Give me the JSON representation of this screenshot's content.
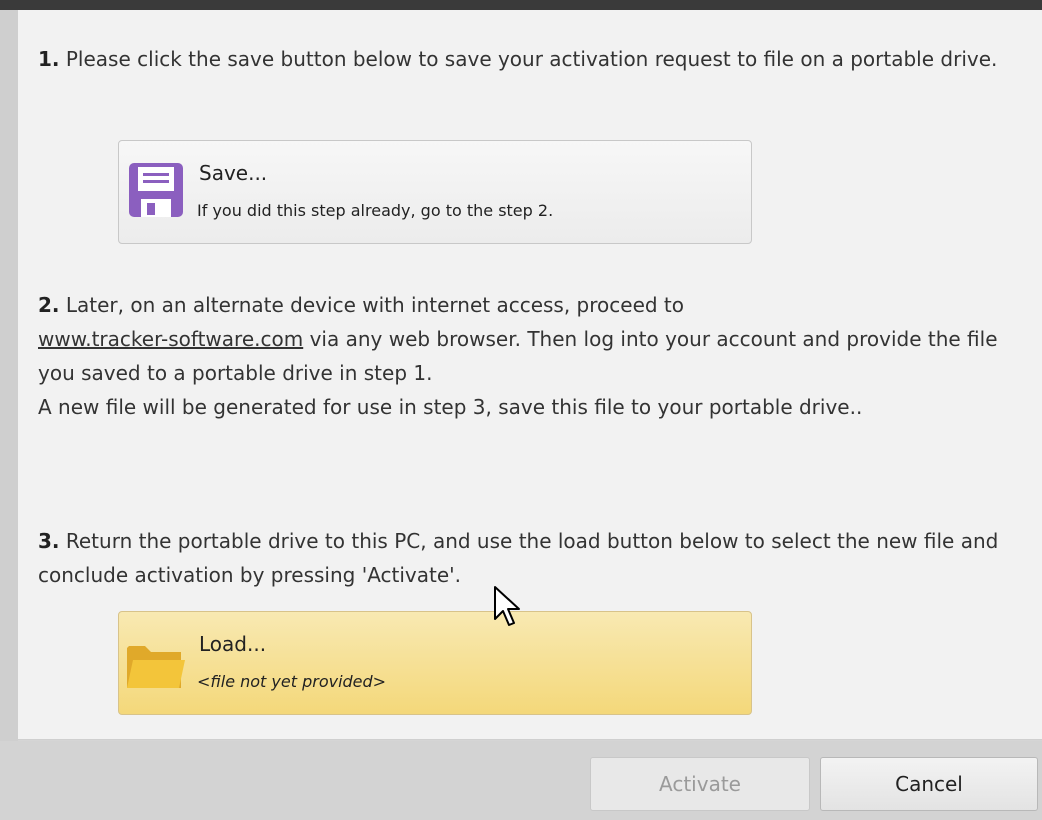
{
  "step1": {
    "number": "1.",
    "text": "Please click the save button below to save your activation request to file on a portable drive."
  },
  "save_button": {
    "title": "Save...",
    "subtitle": "If you did this step already, go to the step 2.",
    "icon": "floppy-disk-icon"
  },
  "step2": {
    "number": "2.",
    "text_before_link": "Later, on an alternate device with internet access, proceed to",
    "link": "www.tracker-software.com",
    "text_after_link": "via any web browser. Then log into your account and provide the file you saved to a portable drive in step 1.",
    "text_line2": "A new file will be generated for use in step 3, save this file to your portable drive.."
  },
  "step3": {
    "number": "3.",
    "text": "Return the portable drive to this PC, and use the load button below to select the new file and conclude activation by pressing 'Activate'."
  },
  "load_button": {
    "title": "Load...",
    "subtitle": "<file not yet provided>",
    "icon": "folder-icon"
  },
  "footer": {
    "activate_label": "Activate",
    "cancel_label": "Cancel"
  },
  "colors": {
    "load_button_bg": "#f4d87a",
    "save_icon": "#8b5fbf",
    "folder_icon": "#f3c53a"
  }
}
